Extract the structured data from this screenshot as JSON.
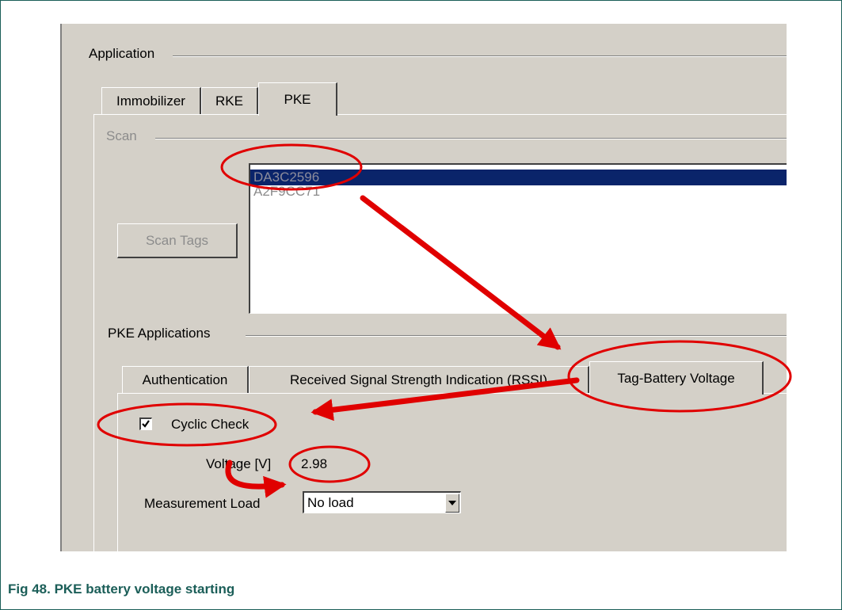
{
  "application": {
    "group_label": "Application",
    "tabs": [
      "Immobilizer",
      "RKE",
      "PKE"
    ],
    "active_tab": "PKE"
  },
  "scan": {
    "group_label": "Scan",
    "button_label": "Scan Tags",
    "tags": [
      {
        "id": "DA3C2596",
        "selected": true
      },
      {
        "id": "A2F9CC71",
        "selected": false
      }
    ]
  },
  "pke_apps": {
    "group_label": "PKE Applications",
    "tabs": [
      "Authentication",
      "Received Signal Strength Indication (RSSI)",
      "Tag-Battery Voltage"
    ],
    "active_tab": "Tag-Battery Voltage"
  },
  "battery": {
    "cyclic_check_label": "Cyclic Check",
    "cyclic_check_checked": true,
    "voltage_label": "Voltage [V]",
    "voltage_value": "2.98",
    "load_label": "Measurement Load",
    "load_value": "No load"
  },
  "caption": "Fig 48.   PKE battery voltage starting",
  "colors": {
    "annotation_red": "#e00000",
    "caption_teal": "#1b5e58",
    "selection_blue": "#0a246a"
  },
  "icons": [
    "checkmark-icon",
    "dropdown-arrow-icon"
  ]
}
